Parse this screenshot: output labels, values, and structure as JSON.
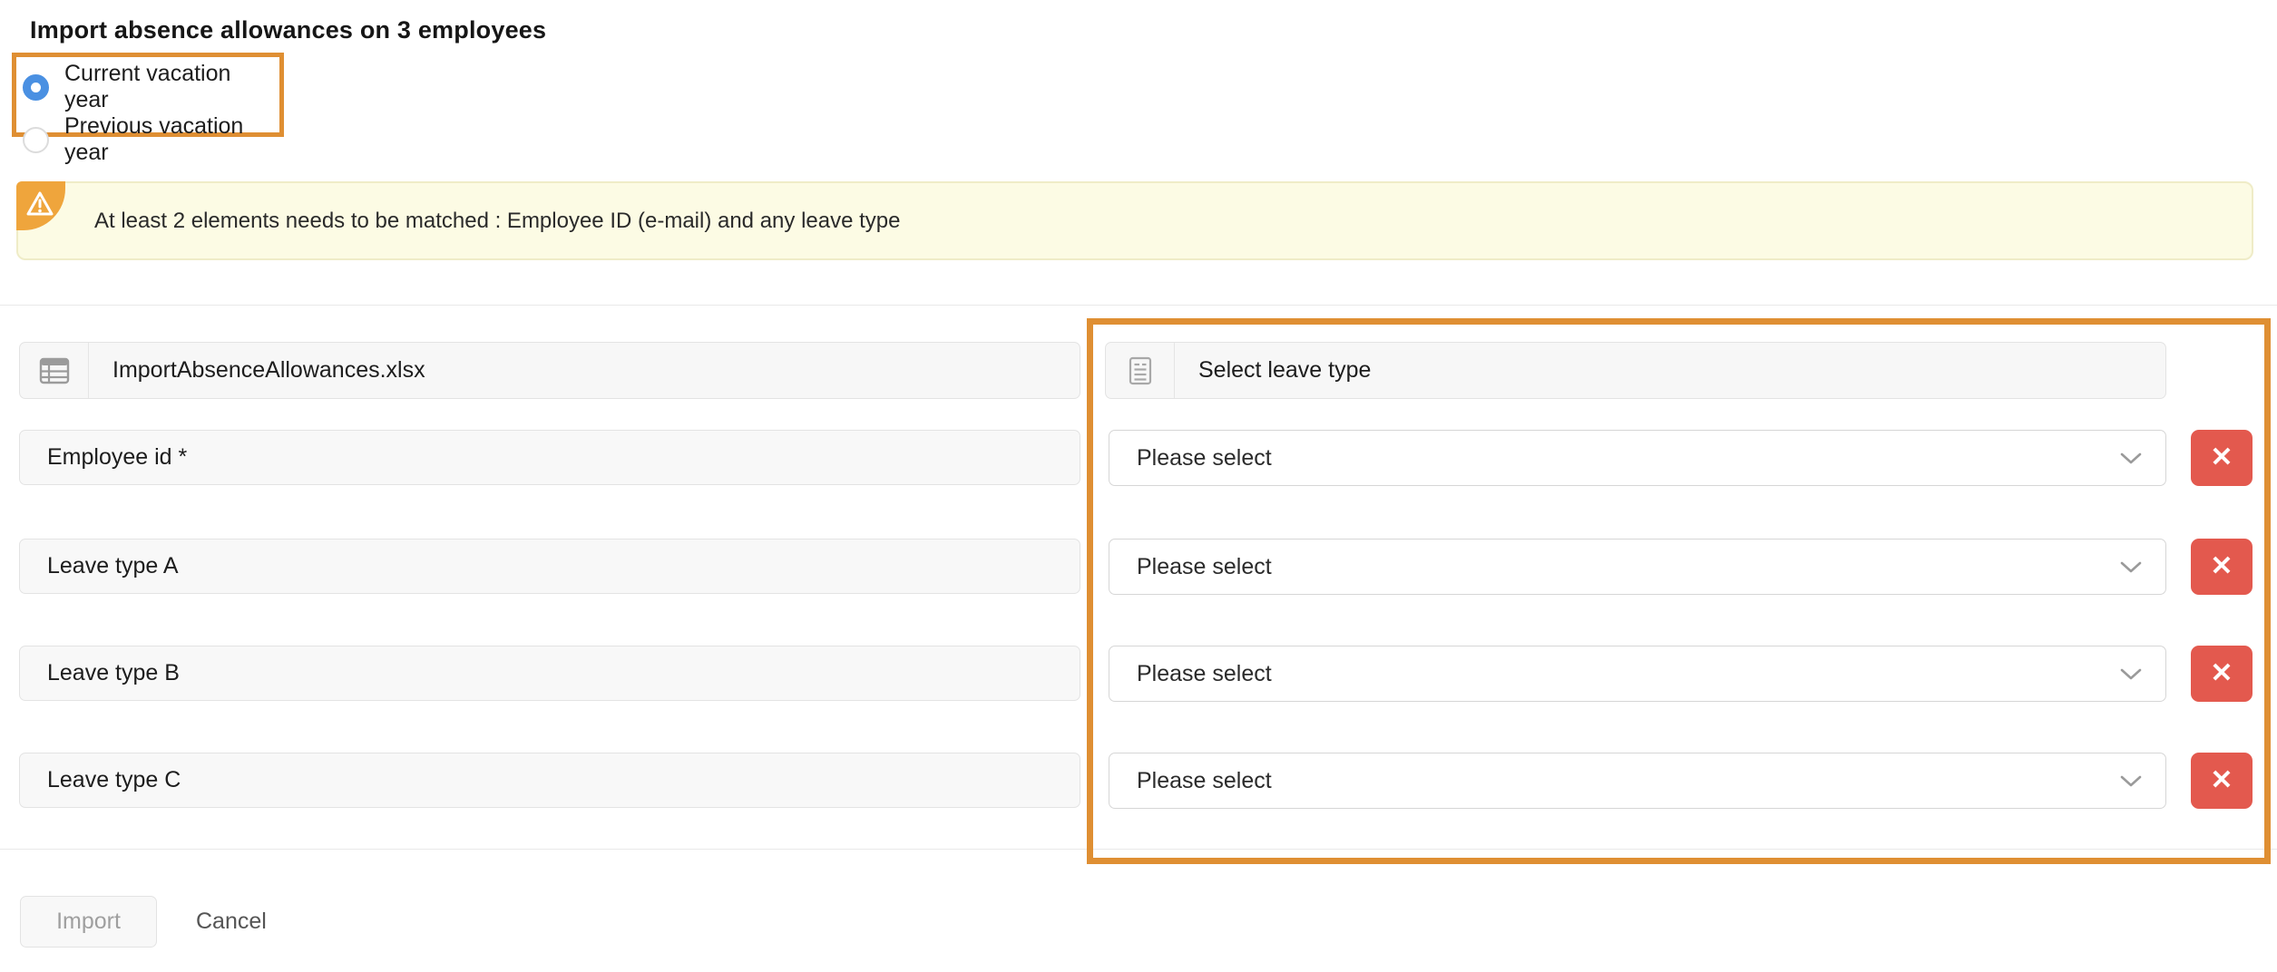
{
  "page": {
    "title": "Import absence allowances on 3 employees"
  },
  "vacation_year": {
    "options": [
      {
        "label": "Current vacation year",
        "selected": true
      },
      {
        "label": "Previous vacation year",
        "selected": false
      }
    ]
  },
  "warning_banner": {
    "icon": "warning-triangle-icon",
    "text": "At least 2 elements needs to be matched : Employee ID (e-mail) and any leave type"
  },
  "source_file": {
    "icon": "spreadsheet-table-icon",
    "filename": "ImportAbsenceAllowances.xlsx"
  },
  "leave_type_header": {
    "icon": "document-lines-icon",
    "label": "Select leave type"
  },
  "mapping": {
    "rows": [
      {
        "source_label": "Employee id *",
        "select_value": "Please select"
      },
      {
        "source_label": "Leave type A",
        "select_value": "Please select"
      },
      {
        "source_label": "Leave type B",
        "select_value": "Please select"
      },
      {
        "source_label": "Leave type C",
        "select_value": "Please select"
      }
    ],
    "remove_button_glyph": "✕"
  },
  "footer": {
    "import_label": "Import",
    "cancel_label": "Cancel"
  },
  "colors": {
    "annotation_orange": "#DF8F33",
    "badge_orange": "#EFA53C",
    "radio_selected_blue": "#4A90E2",
    "remove_button_red": "#E3594E",
    "banner_background": "#FCFBE4"
  }
}
